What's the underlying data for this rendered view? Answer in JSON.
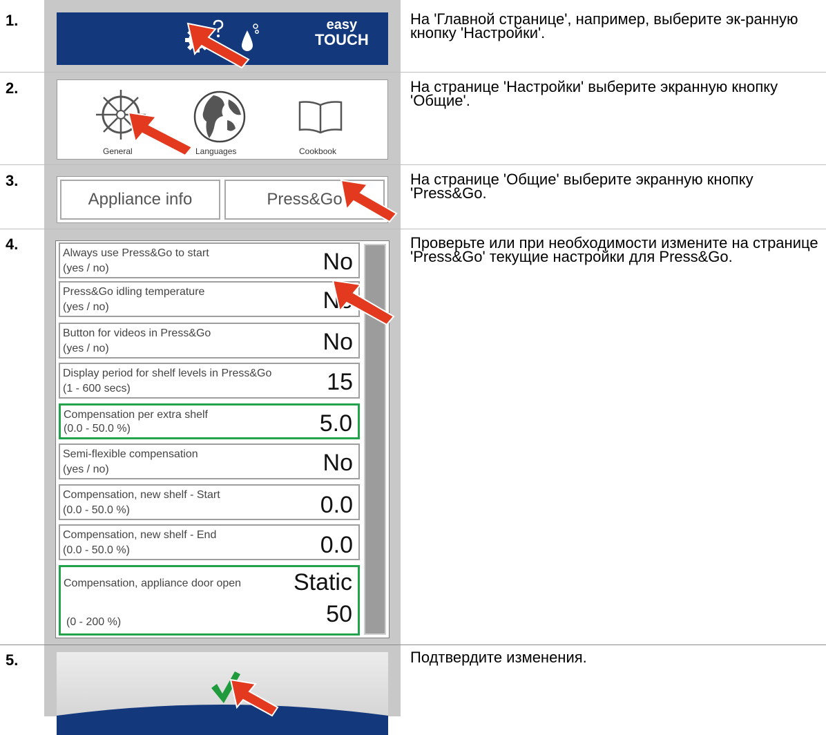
{
  "steps": [
    {
      "num": "1.",
      "text": "На 'Главной странице', например, выберите эк-ранную кнопку 'Настройки'."
    },
    {
      "num": "2.",
      "text": "На странице 'Настройки' выберите экранную кнопку 'Общие'."
    },
    {
      "num": "3.",
      "text": "На странице 'Общие' выберите экранную кнопку 'Press&Go."
    },
    {
      "num": "4.",
      "text": "Проверьте или при необходимости измените на странице 'Press&Go' текущие настройки для Press&Go."
    },
    {
      "num": "5.",
      "text": "Подтвердите изменения."
    }
  ],
  "step1": {
    "logo_line1": "easy",
    "logo_line2": "TOUCH",
    "icons": [
      "gear-icon",
      "question-mark-icon",
      "water-drop-icon"
    ],
    "bar_color": "#13387c"
  },
  "step2": {
    "tiles": [
      {
        "label": "General",
        "icon": "steering-wheel-icon"
      },
      {
        "label": "Languages",
        "icon": "globe-icon"
      },
      {
        "label": "Cookbook",
        "icon": "open-book-icon"
      }
    ]
  },
  "step3": {
    "tabs": [
      "Appliance info",
      "Press&Go"
    ]
  },
  "step4": {
    "rows": [
      {
        "label": "Always use Press&Go to start",
        "range": "(yes / no)",
        "value": "No"
      },
      {
        "label": "Press&Go idling temperature",
        "range": "(yes / no)",
        "value": "No"
      },
      {
        "label": "Button for videos in Press&Go",
        "range": "(yes / no)",
        "value": "No"
      },
      {
        "label": "Display period for shelf levels in Press&Go",
        "range": "(1 - 600 secs)",
        "value": "15"
      },
      {
        "label": "Compensation per extra shelf",
        "range": "(0.0 - 50.0 %)",
        "value": "5.0"
      },
      {
        "label": "Semi-flexible compensation",
        "range": "(yes / no)",
        "value": "No"
      },
      {
        "label": "Compensation, new shelf - Start",
        "range": "(0.0 - 50.0 %)",
        "value": "0.0"
      },
      {
        "label": "Compensation, new shelf - End",
        "range": "(0.0 - 50.0 %)",
        "value": "0.0"
      },
      {
        "label": "Compensation, appliance door open",
        "range": "(0 - 200 %)",
        "value": "Static",
        "value2": "50"
      }
    ],
    "highlight_color": "#21a24b"
  },
  "step5": {
    "icon": "checkmark-icon",
    "check_color": "#1f9a3c"
  },
  "arrow_color": "#e2391f"
}
